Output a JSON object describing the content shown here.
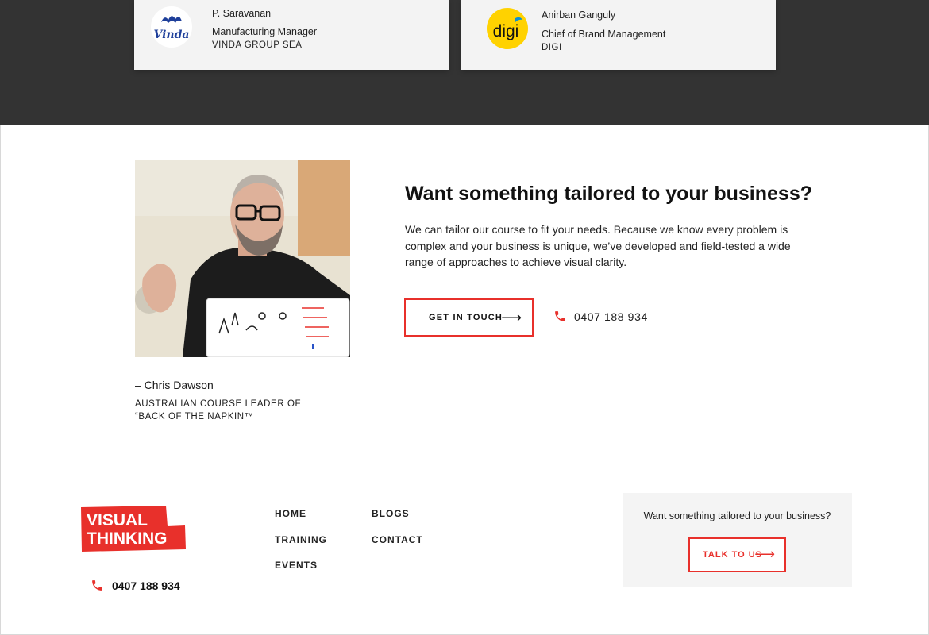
{
  "testimonials": [
    {
      "name": "P. Saravanan",
      "role": "Manufacturing Manager",
      "company": "VINDA GROUP SEA",
      "logo_text": "Vinda",
      "logo_color": "#1e3f9a"
    },
    {
      "name": "Anirban Ganguly",
      "role": "Chief of Brand Management",
      "company": "DIGI",
      "logo_text": "digi",
      "logo_color": "#ffd200"
    }
  ],
  "feature": {
    "heading": "Want something tailored to your business?",
    "body": "We can tailor our course to fit your needs. Because we know every problem is complex and your business is unique, we’ve developed and field-tested a wide range of approaches to achieve visual clarity.",
    "button_label": "GET IN TOUCH",
    "button_arrow": "⟶",
    "phone": "0407 188 934"
  },
  "quote": {
    "name": "– Chris Dawson",
    "title_line1": "AUSTRALIAN COURSE LEADER OF",
    "title_line2": "“BACK OF THE NAPKIN™"
  },
  "footer": {
    "logo_line1": "VISUAL",
    "logo_line2": "THINKING",
    "phone": "0407 188 934",
    "nav_col1": [
      "HOME",
      "TRAINING",
      "EVENTS"
    ],
    "nav_col2": [
      "BLOGS",
      "CONTACT"
    ],
    "box_text": "Want something tailored to your business?",
    "box_button": "TALK TO US",
    "box_arrow": "⟶"
  },
  "colors": {
    "accent": "#e8302b",
    "dark_band": "#333333",
    "card_bg": "#f3f3f3"
  },
  "icons": {
    "phone": "phone-icon",
    "arrow": "arrow-right-icon"
  }
}
